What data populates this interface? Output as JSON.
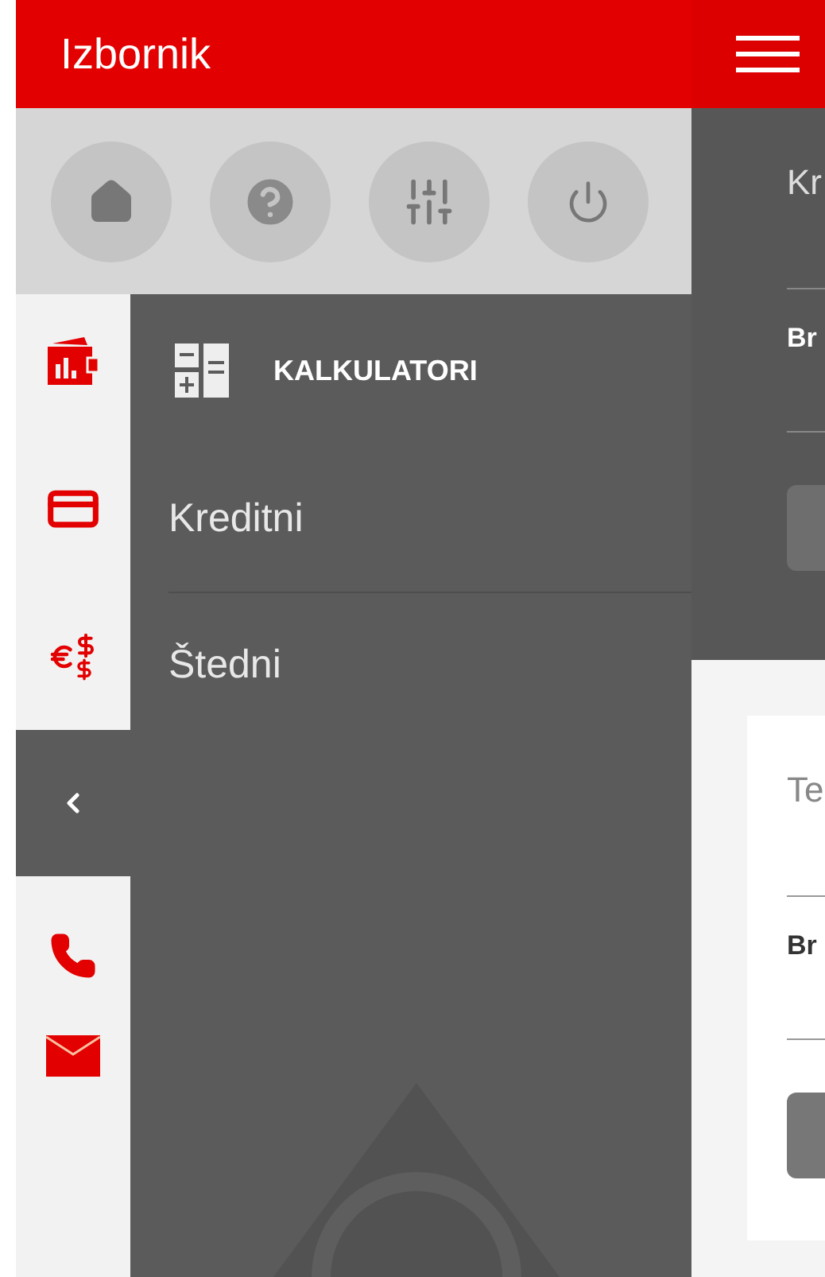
{
  "header": {
    "title": "Izbornik"
  },
  "menu": {
    "section_title": "KALKULATORI",
    "items": [
      {
        "label": "Kreditni"
      },
      {
        "label": "Štedni"
      }
    ]
  },
  "background_screen": {
    "top_card": {
      "field_label": "Kr",
      "row_label": "Br"
    },
    "bottom_card": {
      "field_label": "Te",
      "row_label": "Br"
    }
  }
}
